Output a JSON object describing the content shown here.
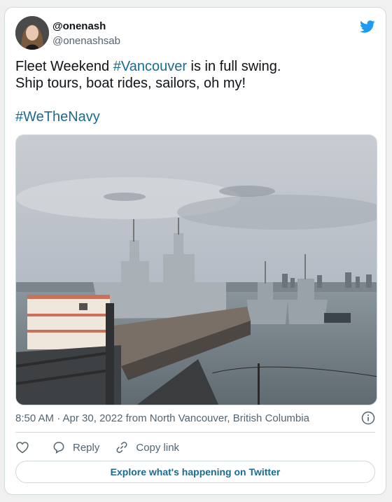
{
  "author": {
    "display_name": "@onenash",
    "handle": "@onenashsab"
  },
  "tweet": {
    "line1_before": "Fleet Weekend ",
    "line1_hashtag": "#Vancouver",
    "line1_after": " is in full swing.",
    "line2": "Ship tours, boat rides, sailors, oh my!",
    "hashtag_line": "#WeTheNavy"
  },
  "meta": {
    "timestamp": "8:50 AM · Apr 30, 2022 from North Vancouver, British Columbia"
  },
  "actions": {
    "like_label": "",
    "reply_label": "Reply",
    "copy_label": "Copy link"
  },
  "explore_label": "Explore what's happening on Twitter",
  "icons": {
    "brand": "twitter-bird-icon",
    "info": "info-icon",
    "like": "heart-icon",
    "reply": "reply-icon",
    "copy": "link-icon"
  },
  "colors": {
    "hashtag": "#1b6a8f",
    "twitter_blue": "#1d9bf0",
    "muted": "#536471",
    "border": "#cfd9de"
  }
}
